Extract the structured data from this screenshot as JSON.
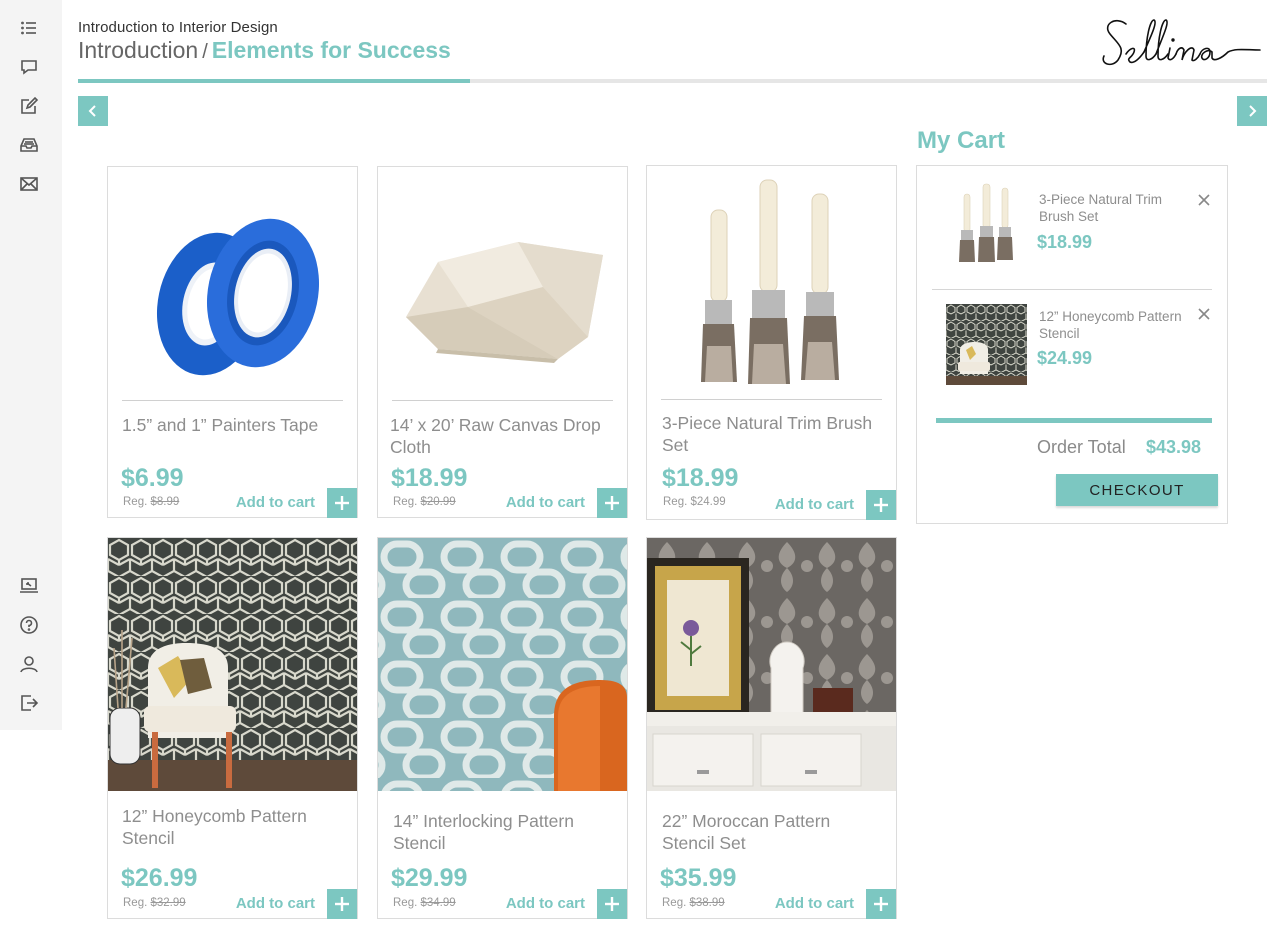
{
  "header": {
    "course_title": "Introduction to Interior Design",
    "breadcrumb_first": "Introduction",
    "breadcrumb_separator": "/",
    "breadcrumb_current": "Elements for Success",
    "logo_text": "Sellina",
    "progress": 0.33
  },
  "sidebar": {
    "top_icons": [
      "list-icon",
      "chat-icon",
      "edit-icon",
      "inbox-icon",
      "mail-icon"
    ],
    "bottom_icons": [
      "monitor-icon",
      "help-icon",
      "user-icon",
      "logout-icon"
    ]
  },
  "products": [
    {
      "name": "1.5” and 1” Painters Tape",
      "price": "$6.99",
      "reg_prefix": "Reg.",
      "reg_price": "$8.99",
      "add_label": "Add to cart",
      "image": "painters-tape"
    },
    {
      "name": "14’ x 20’ Raw Canvas Drop Cloth",
      "price": "$18.99",
      "reg_prefix": "Reg.",
      "reg_price": "$20.99",
      "add_label": "Add to cart",
      "image": "drop-cloth"
    },
    {
      "name": "3-Piece Natural Trim Brush Set",
      "price": "$18.99",
      "reg_prefix": "Reg.",
      "reg_price": "$24.99",
      "add_label": "Add to cart",
      "image": "brush-set"
    },
    {
      "name": "12” Honeycomb Pattern Stencil",
      "price": "$26.99",
      "reg_prefix": "Reg.",
      "reg_price": "$32.99",
      "add_label": "Add to cart",
      "image": "honeycomb-room"
    },
    {
      "name": "14” Interlocking Pattern Stencil",
      "price": "$29.99",
      "reg_prefix": "Reg.",
      "reg_price": "$34.99",
      "add_label": "Add to cart",
      "image": "interlocking-wall"
    },
    {
      "name": "22” Moroccan Pattern Stencil Set",
      "price": "$35.99",
      "reg_prefix": "Reg.",
      "reg_price": "$38.99",
      "add_label": "Add to cart",
      "image": "moroccan-room"
    }
  ],
  "cart": {
    "title": "My Cart",
    "items": [
      {
        "name": "3-Piece Natural Trim Brush Set",
        "price": "$18.99"
      },
      {
        "name": "12” Honeycomb Pattern Stencil",
        "price": "$24.99"
      }
    ],
    "total_label": "Order Total",
    "total_value": "$43.98",
    "checkout_label": "CHECKOUT"
  },
  "colors": {
    "accent": "#7cc7c1",
    "sidebar_bg": "#f4f4f4",
    "text_muted": "#8e8e8e"
  }
}
